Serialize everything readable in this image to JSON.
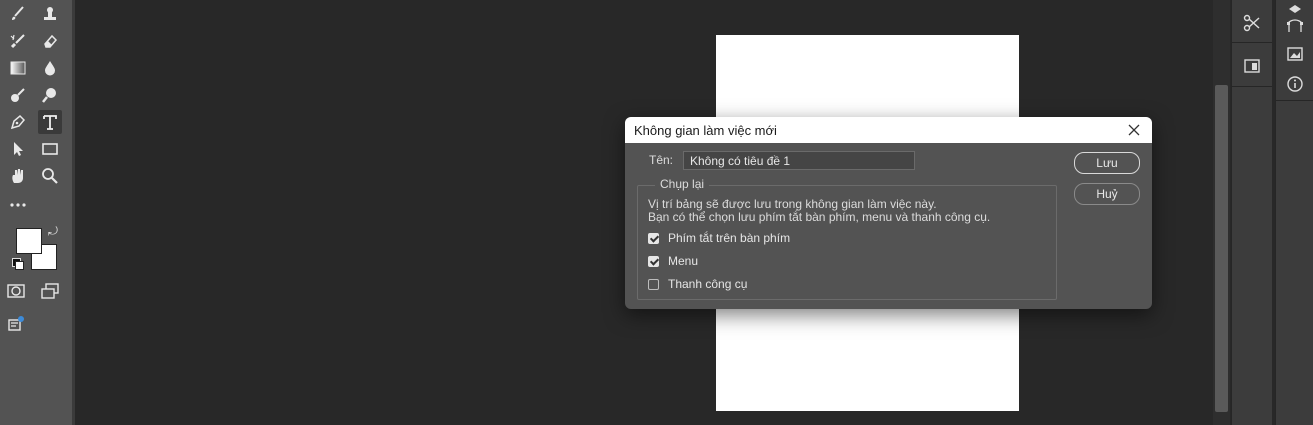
{
  "dialog": {
    "title": "Không gian làm việc mới",
    "name_label": "Tên:",
    "name_value": "Không có tiêu đề 1",
    "save_button": "Lưu",
    "cancel_button": "Huỷ",
    "group_label": "Chụp lại",
    "description_line1": "Vị trí bảng sẽ được lưu trong không gian làm việc này.",
    "description_line2": "Bạn có thể chọn lưu phím tắt bàn phím, menu và thanh công cụ.",
    "options": [
      {
        "label": "Phím tắt trên bàn phím",
        "checked": true
      },
      {
        "label": "Menu",
        "checked": true
      },
      {
        "label": "Thanh công cụ",
        "checked": false
      }
    ]
  },
  "toolbar": {
    "tools": [
      "brush-icon",
      "clone-stamp-icon",
      "history-brush-icon",
      "eraser-icon",
      "gradient-icon",
      "blur-drop-icon",
      "dodge-icon",
      "zoom-lens-icon",
      "pen-icon",
      "type-icon",
      "path-select-icon",
      "rectangle-icon",
      "hand-icon",
      "zoom-icon",
      "more-tools-icon",
      "quick-mask-icon",
      "screen-mode-icon",
      "edit-toolbar-icon"
    ],
    "foreground_color": "#ffffff",
    "background_color": "#ffffff"
  },
  "right_panels": {
    "col1": [
      "tools-options-icon",
      "layers-panel-icon"
    ],
    "col2": [
      "styles-icon",
      "paths-icon",
      "channels-icon",
      "info-icon"
    ]
  },
  "colors": {
    "workspace": "#282828",
    "panel": "#535353",
    "document": "#ffffff"
  }
}
